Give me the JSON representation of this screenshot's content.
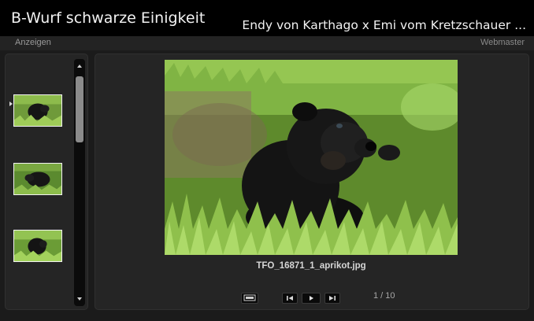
{
  "header": {
    "site_title": "B-Wurf schwarze Einigkeit",
    "gallery_title": "Endy von Karthago x Emi vom Kretzschauer ..."
  },
  "subbar": {
    "nav_label": "Anzeigen",
    "webmaster_label": "Webmaster"
  },
  "filmstrip": {
    "selected_index": 0,
    "scrollbar_icons": {
      "up": "chevron-up-icon",
      "down": "chevron-down-icon"
    }
  },
  "viewer": {
    "caption": "TFO_16871_1_aprikot.jpg",
    "counter": "1 / 10",
    "controls": {
      "slideshow": "monitor-icon",
      "previous": "previous-icon",
      "play": "play-icon",
      "next": "next-icon"
    }
  },
  "colors": {
    "header_bg": "#000000",
    "page_bg": "#1b1b1b",
    "panel_bg": "#252525",
    "text": "#f2f2f2",
    "muted": "#9a9a9a"
  }
}
